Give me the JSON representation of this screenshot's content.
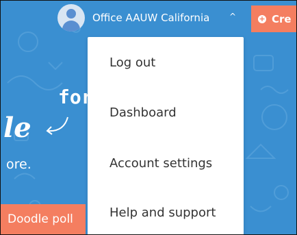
{
  "header": {
    "user_name": "Office AAUW California",
    "create_label": "Cre"
  },
  "hero": {
    "for_text": "for",
    "title_fragment": "le",
    "subtitle_fragment": "ore.",
    "poll_button_label": "Doodle poll"
  },
  "menu": {
    "items": [
      {
        "label": "Log out"
      },
      {
        "label": "Dashboard"
      },
      {
        "label": "Account settings"
      },
      {
        "label": "Help and support"
      }
    ]
  },
  "colors": {
    "background": "#3a8fd1",
    "accent": "#f47e60",
    "menu_bg": "#ffffff"
  },
  "icons": [
    "avatar-icon",
    "chevron-up-icon",
    "plus-circle-icon",
    "curved-arrow-icon"
  ]
}
